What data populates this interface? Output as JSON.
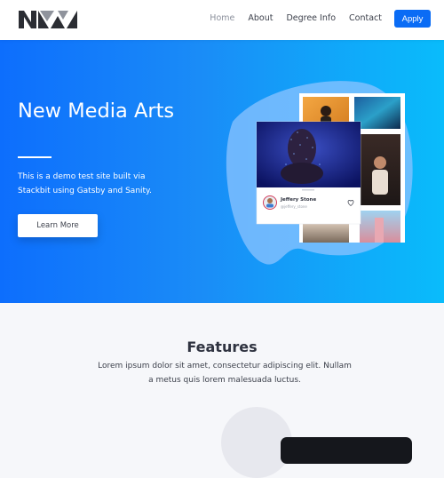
{
  "header": {
    "logo_icon": "nma-logo-icon",
    "nav": [
      {
        "label": "Home",
        "active": true
      },
      {
        "label": "About",
        "active": false
      },
      {
        "label": "Degree Info",
        "active": false
      },
      {
        "label": "Contact",
        "active": false
      }
    ],
    "apply_label": "Apply"
  },
  "hero": {
    "title": "New Media Arts",
    "subtitle": "This is a demo test site built via Stackbit using Gatsby and Sanity.",
    "button_label": "Learn More",
    "profile_card": {
      "name": "Jeffery Stone",
      "handle": "@jeffery_stone",
      "like_icon": "heart-icon"
    }
  },
  "features": {
    "title": "Features",
    "text": "Lorem ipsum dolor sit amet, consectetur adipiscing elit. Nullam a metus quis lorem malesuada luctus."
  },
  "colors": {
    "accent": "#0a6cf5",
    "hero_gradient_start": "#0d6efd",
    "hero_gradient_end": "#09bcfb",
    "background": "#f6f7fa"
  }
}
